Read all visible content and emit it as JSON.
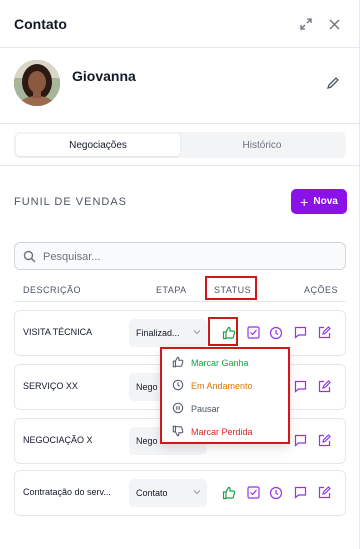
{
  "header": {
    "title": "Contato"
  },
  "profile": {
    "name": "Giovanna"
  },
  "tabs": [
    {
      "label": "Negociações",
      "active": true
    },
    {
      "label": "Histórico",
      "active": false
    }
  ],
  "funnel": {
    "title": "FUNIL DE VENDAS",
    "new_button": "Nova"
  },
  "search": {
    "placeholder": "Pesquisar..."
  },
  "table": {
    "columns": [
      "DESCRIÇÃO",
      "ETAPA",
      "STATUS",
      "AÇÕES"
    ],
    "rows": [
      {
        "description": "VISITA TÉCNICA",
        "stage": "Finalizad..."
      },
      {
        "description": "SERVIÇO XX",
        "stage": "Nego"
      },
      {
        "description": "NEGOCIAÇÃO X",
        "stage": "Nego"
      },
      {
        "description": "Contratação do serv...",
        "stage": "Contato"
      }
    ]
  },
  "status_menu": {
    "items": [
      {
        "label": "Marcar Ganha",
        "color": "#16a34a",
        "icon": "thumbs-up-icon"
      },
      {
        "label": "Em Andamento",
        "color": "#d97706",
        "icon": "clock-icon"
      },
      {
        "label": "Pausar",
        "color": "#4b5563",
        "icon": "pause-icon"
      },
      {
        "label": "Marcar Perdida",
        "color": "#dc2626",
        "icon": "thumbs-down-icon"
      }
    ]
  },
  "colors": {
    "accent": "#8b12e6",
    "success": "#16a34a",
    "highlight": "#d01818"
  }
}
